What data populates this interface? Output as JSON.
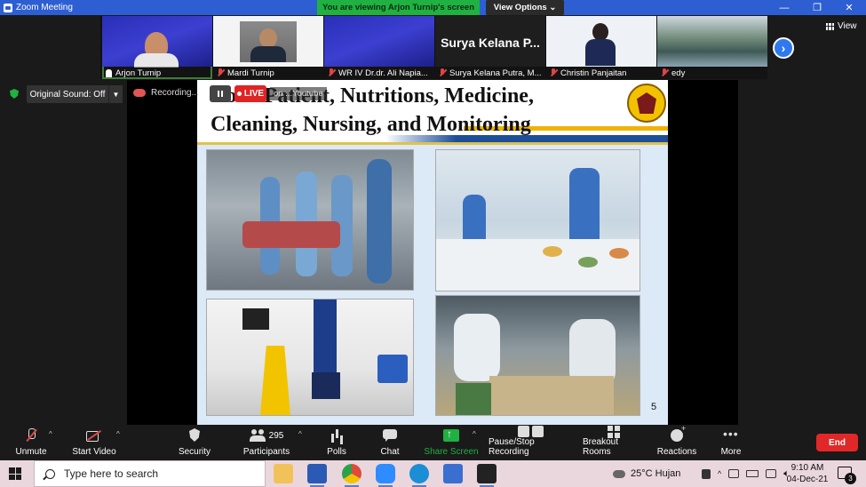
{
  "window": {
    "title": "Zoom Meeting",
    "minimize": "—",
    "maximize": "❐",
    "close": "✕"
  },
  "banner": {
    "viewing_text": "You are viewing Arjon Turnip's screen",
    "view_options": "View Options"
  },
  "gallery": {
    "tiles": [
      {
        "name": "Arjon Turnip",
        "muted": false,
        "pinned": true,
        "active": true
      },
      {
        "name": "Mardi Turnip",
        "muted": true
      },
      {
        "name": "WR IV Dr.dr. Ali Napia...",
        "muted": true
      },
      {
        "name": "Surya Kelana Putra, M...",
        "muted": true,
        "name_display": "Surya Kelana P..."
      },
      {
        "name": "Christin Panjaitan",
        "muted": true
      },
      {
        "name": "edy",
        "muted": true
      }
    ],
    "view_label": "View"
  },
  "subtoolbar": {
    "original_sound": "Original Sound: Off",
    "recording": "Recording..."
  },
  "live": {
    "label": "LIVE",
    "status_text": "on ...Youtube"
  },
  "slide": {
    "title_line1": "Cost: Patient, Nutritions, Medicine,",
    "title_line2": "Cleaning, Nursing, and Monitoring",
    "page_number": "5"
  },
  "controls": {
    "unmute": "Unmute",
    "start_video": "Start Video",
    "security": "Security",
    "participants": "Participants",
    "participants_count": "295",
    "polls": "Polls",
    "chat": "Chat",
    "share_screen": "Share Screen",
    "pause_recording": "Pause/Stop Recording",
    "breakout_rooms": "Breakout Rooms",
    "reactions": "Reactions",
    "more": "More",
    "end": "End"
  },
  "taskbar": {
    "search_placeholder": "Type here to search",
    "weather": "25°C  Hujan",
    "time": "9:10 AM",
    "date": "04-Dec-21",
    "notifications": "3"
  },
  "colors": {
    "accent": "#2d5fd3",
    "banner_green": "#1fb141",
    "end_red": "#e02828"
  }
}
